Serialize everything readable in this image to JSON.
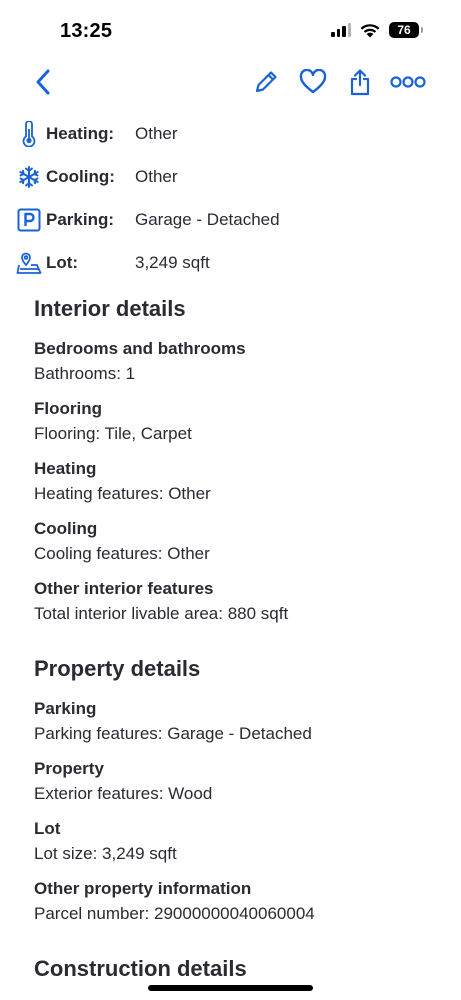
{
  "status_bar": {
    "time": "13:25",
    "battery": "76"
  },
  "nav": {
    "accent": "#1a63d6",
    "icons": [
      "chevron-left",
      "pencil",
      "heart",
      "share",
      "more-circles"
    ]
  },
  "facts": [
    {
      "icon": "thermometer",
      "label": "Heating:",
      "value": "Other"
    },
    {
      "icon": "snowflake",
      "label": "Cooling:",
      "value": "Other"
    },
    {
      "icon": "parking-p",
      "label": "Parking:",
      "value": "Garage - Detached"
    },
    {
      "icon": "lot-pin",
      "label": "Lot:",
      "value": "3,249 sqft"
    }
  ],
  "interior": {
    "title": "Interior details",
    "groups": [
      {
        "title": "Bedrooms and bathrooms",
        "line": "Bathrooms: 1"
      },
      {
        "title": "Flooring",
        "line": "Flooring: Tile, Carpet"
      },
      {
        "title": "Heating",
        "line": "Heating features: Other"
      },
      {
        "title": "Cooling",
        "line": "Cooling features: Other"
      },
      {
        "title": "Other interior features",
        "line": "Total interior livable area: 880 sqft"
      }
    ]
  },
  "property": {
    "title": "Property details",
    "groups": [
      {
        "title": "Parking",
        "line": "Parking features: Garage - Detached"
      },
      {
        "title": "Property",
        "line": "Exterior features: Wood"
      },
      {
        "title": "Lot",
        "line": "Lot size: 3,249 sqft"
      },
      {
        "title": "Other property information",
        "line": "Parcel number: 29000000040060004"
      }
    ]
  },
  "construction": {
    "title": "Construction details"
  }
}
